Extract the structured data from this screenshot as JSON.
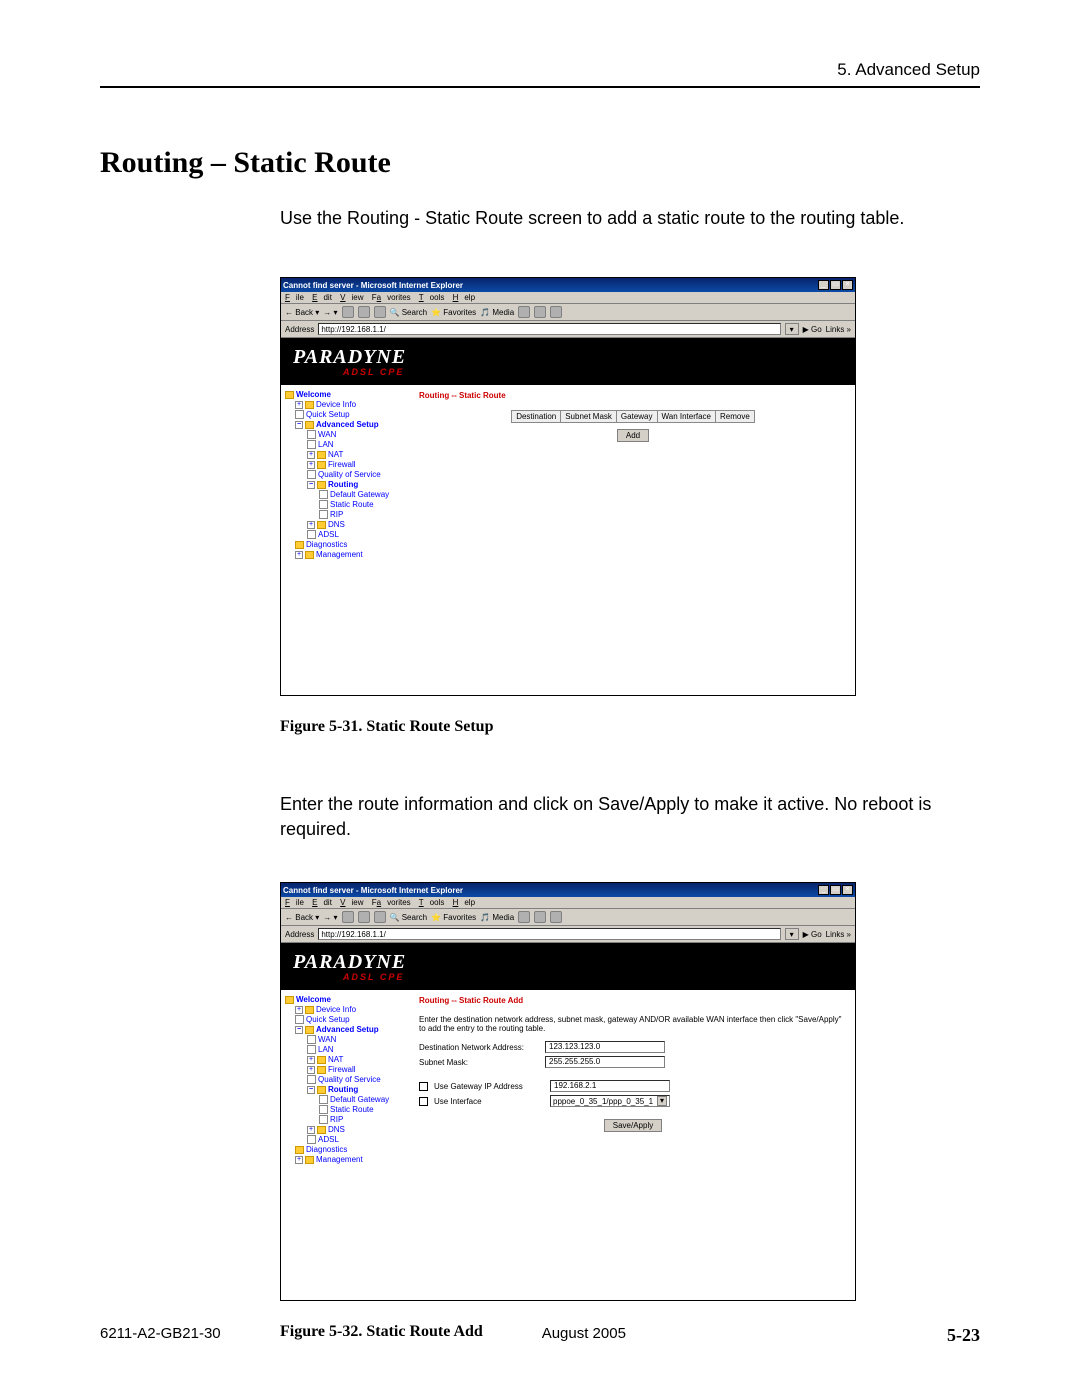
{
  "header": {
    "section": "5. Advanced Setup"
  },
  "title": "Routing – Static Route",
  "intro1": "Use the Routing - Static Route screen to add a static route to the routing table.",
  "intro2": "Enter the route information and click on Save/Apply to make it active. No reboot is required.",
  "figure1_caption": "Figure 5-31.   Static Route Setup",
  "figure2_caption": "Figure 5-32.   Static Route Add",
  "footer": {
    "doc": "6211-A2-GB21-30",
    "date": "August 2005",
    "page": "5-23"
  },
  "browser": {
    "title": "Cannot find server - Microsoft Internet Explorer",
    "menus": [
      "File",
      "Edit",
      "View",
      "Favorites",
      "Tools",
      "Help"
    ],
    "toolbar": {
      "back": "Back",
      "search": "Search",
      "favorites": "Favorites",
      "media": "Media"
    },
    "address_label": "Address",
    "address_value": "http://192.168.1.1/",
    "go": "Go",
    "links": "Links »",
    "brand": "PARADYNE",
    "brand_sub": "ADSL CPE"
  },
  "nav": {
    "welcome": "Welcome",
    "device_info": "Device Info",
    "quick_setup": "Quick Setup",
    "advanced_setup": "Advanced Setup",
    "wan": "WAN",
    "lan": "LAN",
    "nat": "NAT",
    "firewall": "Firewall",
    "qos": "Quality of Service",
    "routing": "Routing",
    "default_gateway": "Default Gateway",
    "static_route": "Static Route",
    "rip": "RIP",
    "dns": "DNS",
    "adsl": "ADSL",
    "diagnostics": "Diagnostics",
    "management": "Management"
  },
  "screen1": {
    "heading": "Routing -- Static Route",
    "cols": [
      "Destination",
      "Subnet Mask",
      "Gateway",
      "Wan Interface",
      "Remove"
    ],
    "add_btn": "Add"
  },
  "screen2": {
    "heading": "Routing -- Static Route Add",
    "instruction": "Enter the destination network address, subnet mask, gateway AND/OR available WAN interface then click \"Save/Apply\" to add the entry to the routing table.",
    "dest_label": "Destination Network Address:",
    "dest_value": "123.123.123.0",
    "mask_label": "Subnet Mask:",
    "mask_value": "255.255.255.0",
    "gw_check_label": "Use Gateway IP Address",
    "gw_value": "192.168.2.1",
    "if_check_label": "Use Interface",
    "if_value": "pppoe_0_35_1/ppp_0_35_1",
    "save_btn": "Save/Apply"
  }
}
